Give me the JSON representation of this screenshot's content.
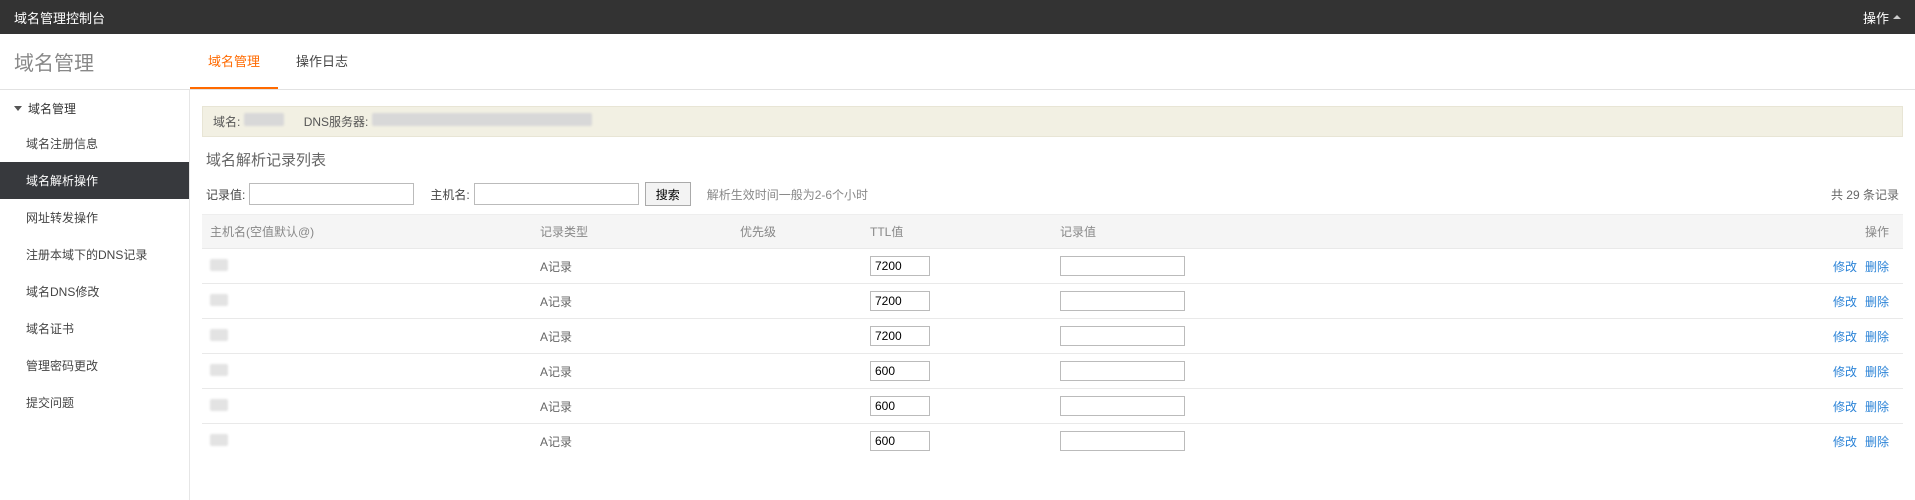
{
  "header": {
    "title": "域名管理控制台",
    "action_label": "操作"
  },
  "page_title": "域名管理",
  "tabs": [
    {
      "label": "域名管理",
      "active": true
    },
    {
      "label": "操作日志",
      "active": false
    }
  ],
  "sidebar": {
    "group_label": "域名管理",
    "items": [
      {
        "label": "域名注册信息",
        "active": false
      },
      {
        "label": "域名解析操作",
        "active": true
      },
      {
        "label": "网址转发操作",
        "active": false
      },
      {
        "label": "注册本域下的DNS记录",
        "active": false
      },
      {
        "label": "域名DNS修改",
        "active": false
      },
      {
        "label": "域名证书",
        "active": false
      },
      {
        "label": "管理密码更改",
        "active": false
      },
      {
        "label": "提交问题",
        "active": false
      }
    ]
  },
  "info_banner": {
    "domain_label": "域名:",
    "dns_label": "DNS服务器:"
  },
  "section_title": "域名解析记录列表",
  "search": {
    "record_value_label": "记录值:",
    "hostname_label": "主机名:",
    "button_label": "搜索",
    "hint": "解析生效时间一般为2-6个小时",
    "count_text": "共 29 条记录"
  },
  "table": {
    "headers": {
      "host": "主机名(空值默认@)",
      "type": "记录类型",
      "priority": "优先级",
      "ttl": "TTL值",
      "value": "记录值",
      "ops": "操作"
    },
    "rows": [
      {
        "host": "",
        "type": "A记录",
        "priority": "",
        "ttl": "7200",
        "value": ""
      },
      {
        "host": "",
        "type": "A记录",
        "priority": "",
        "ttl": "7200",
        "value": ""
      },
      {
        "host": "",
        "type": "A记录",
        "priority": "",
        "ttl": "7200",
        "value": ""
      },
      {
        "host": "",
        "type": "A记录",
        "priority": "",
        "ttl": "600",
        "value": ""
      },
      {
        "host": "",
        "type": "A记录",
        "priority": "",
        "ttl": "600",
        "value": ""
      },
      {
        "host": "",
        "type": "A记录",
        "priority": "",
        "ttl": "600",
        "value": ""
      }
    ],
    "ops_edit": "修改",
    "ops_delete": "删除"
  }
}
